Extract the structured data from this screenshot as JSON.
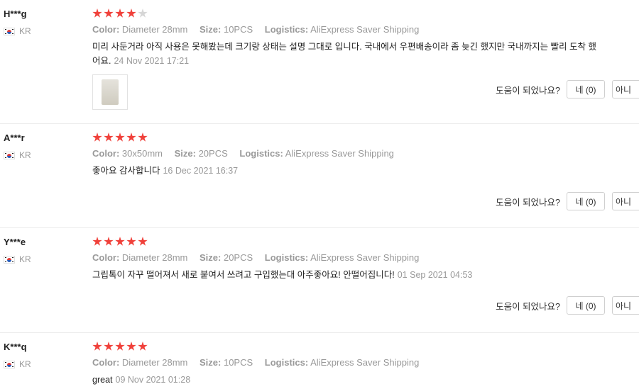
{
  "labels": {
    "color": "Color:",
    "size": "Size:",
    "logistics": "Logistics:",
    "helpful": "도움이 되었나요?",
    "no": "아니"
  },
  "reviews": [
    {
      "user": "H***g",
      "country": "KR",
      "rating": 4,
      "color": "Diameter 28mm",
      "size": "10PCS",
      "logistics": "AliExpress Saver Shipping",
      "text": "미리 사둔거라 아직 사용은 못해봤는데 크기랑 상태는 설명 그대로 입니다. 국내에서 우편배송이라 좀 늦긴 했지만 국내까지는 빨리 도착 했어요.",
      "date": "24 Nov 2021 17:21",
      "yes": "네 (0)"
    },
    {
      "user": "A***r",
      "country": "KR",
      "rating": 5,
      "color": "30x50mm",
      "size": "20PCS",
      "logistics": "AliExpress Saver Shipping",
      "text": "좋아요 감사합니다",
      "date": "16 Dec 2021 16:37",
      "yes": "네 (0)"
    },
    {
      "user": "Y***e",
      "country": "KR",
      "rating": 5,
      "color": "Diameter 28mm",
      "size": "20PCS",
      "logistics": "AliExpress Saver Shipping",
      "text": "그립톡이 자꾸 떨어져서 새로 붙여서 쓰려고 구입했는대 아주좋아요! 안떨어집니다!",
      "date": "01 Sep 2021 04:53",
      "yes": "네 (0)"
    },
    {
      "user": "K***q",
      "country": "KR",
      "rating": 5,
      "color": "Diameter 28mm",
      "size": "10PCS",
      "logistics": "AliExpress Saver Shipping",
      "text": "great",
      "date": "09 Nov 2021 01:28"
    }
  ]
}
